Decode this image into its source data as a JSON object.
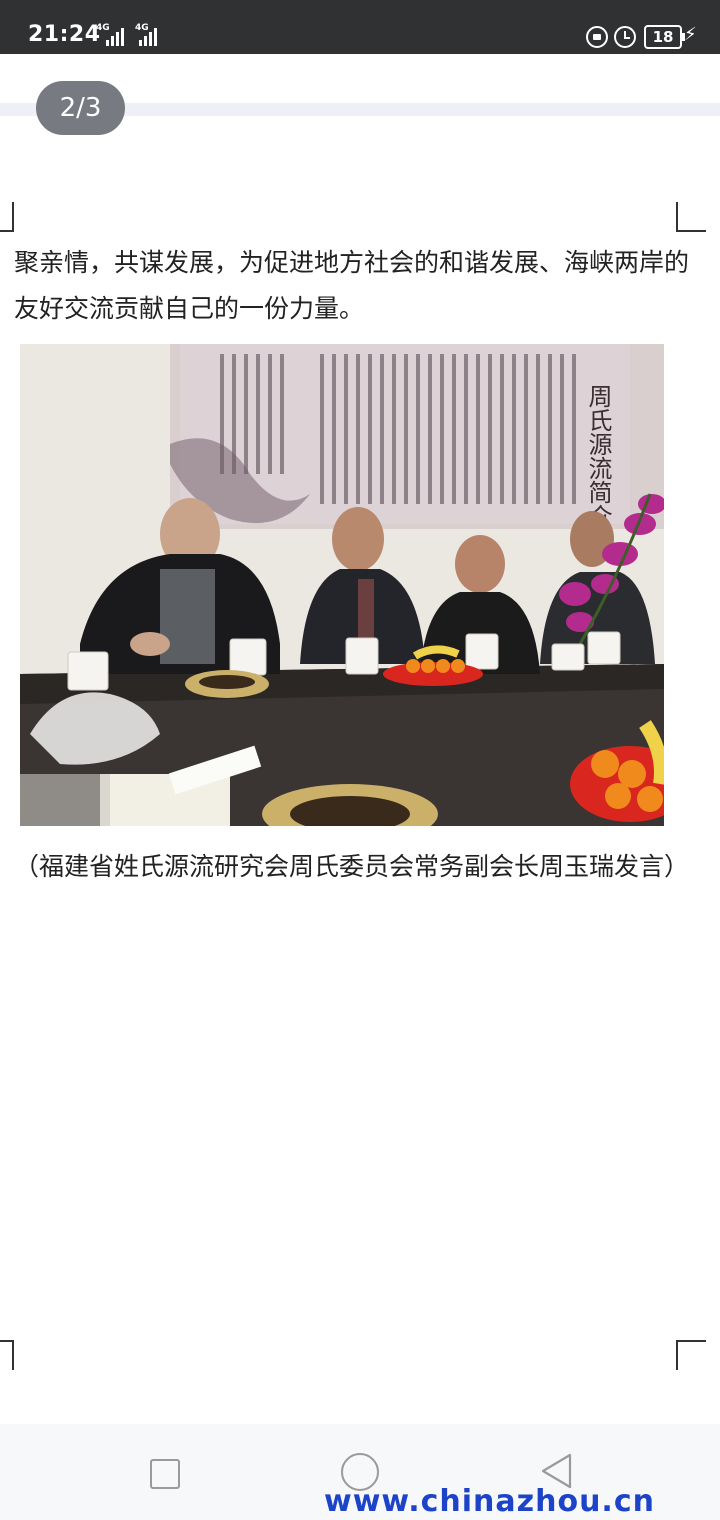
{
  "status_bar": {
    "time": "21:24",
    "network_1": "4G",
    "network_2": "4G",
    "battery_level": "18",
    "charging": true
  },
  "viewer": {
    "page_indicator": "2/3"
  },
  "document": {
    "paragraph": "聚亲情，共谋发展，为促进地方社会的和谐发展、海峡两岸的友好交流贡献自己的一份力量。",
    "caption": "（福建省姓氏源流研究会周氏委员会常务副会长周玉瑞发言）",
    "photo": {
      "banner_title": "周氏源流简介"
    }
  },
  "nav_bar": {
    "recent_icon": "square-icon",
    "home_icon": "circle-icon",
    "back_icon": "triangle-back-icon"
  },
  "watermark": "www.chinazhou.cn"
}
